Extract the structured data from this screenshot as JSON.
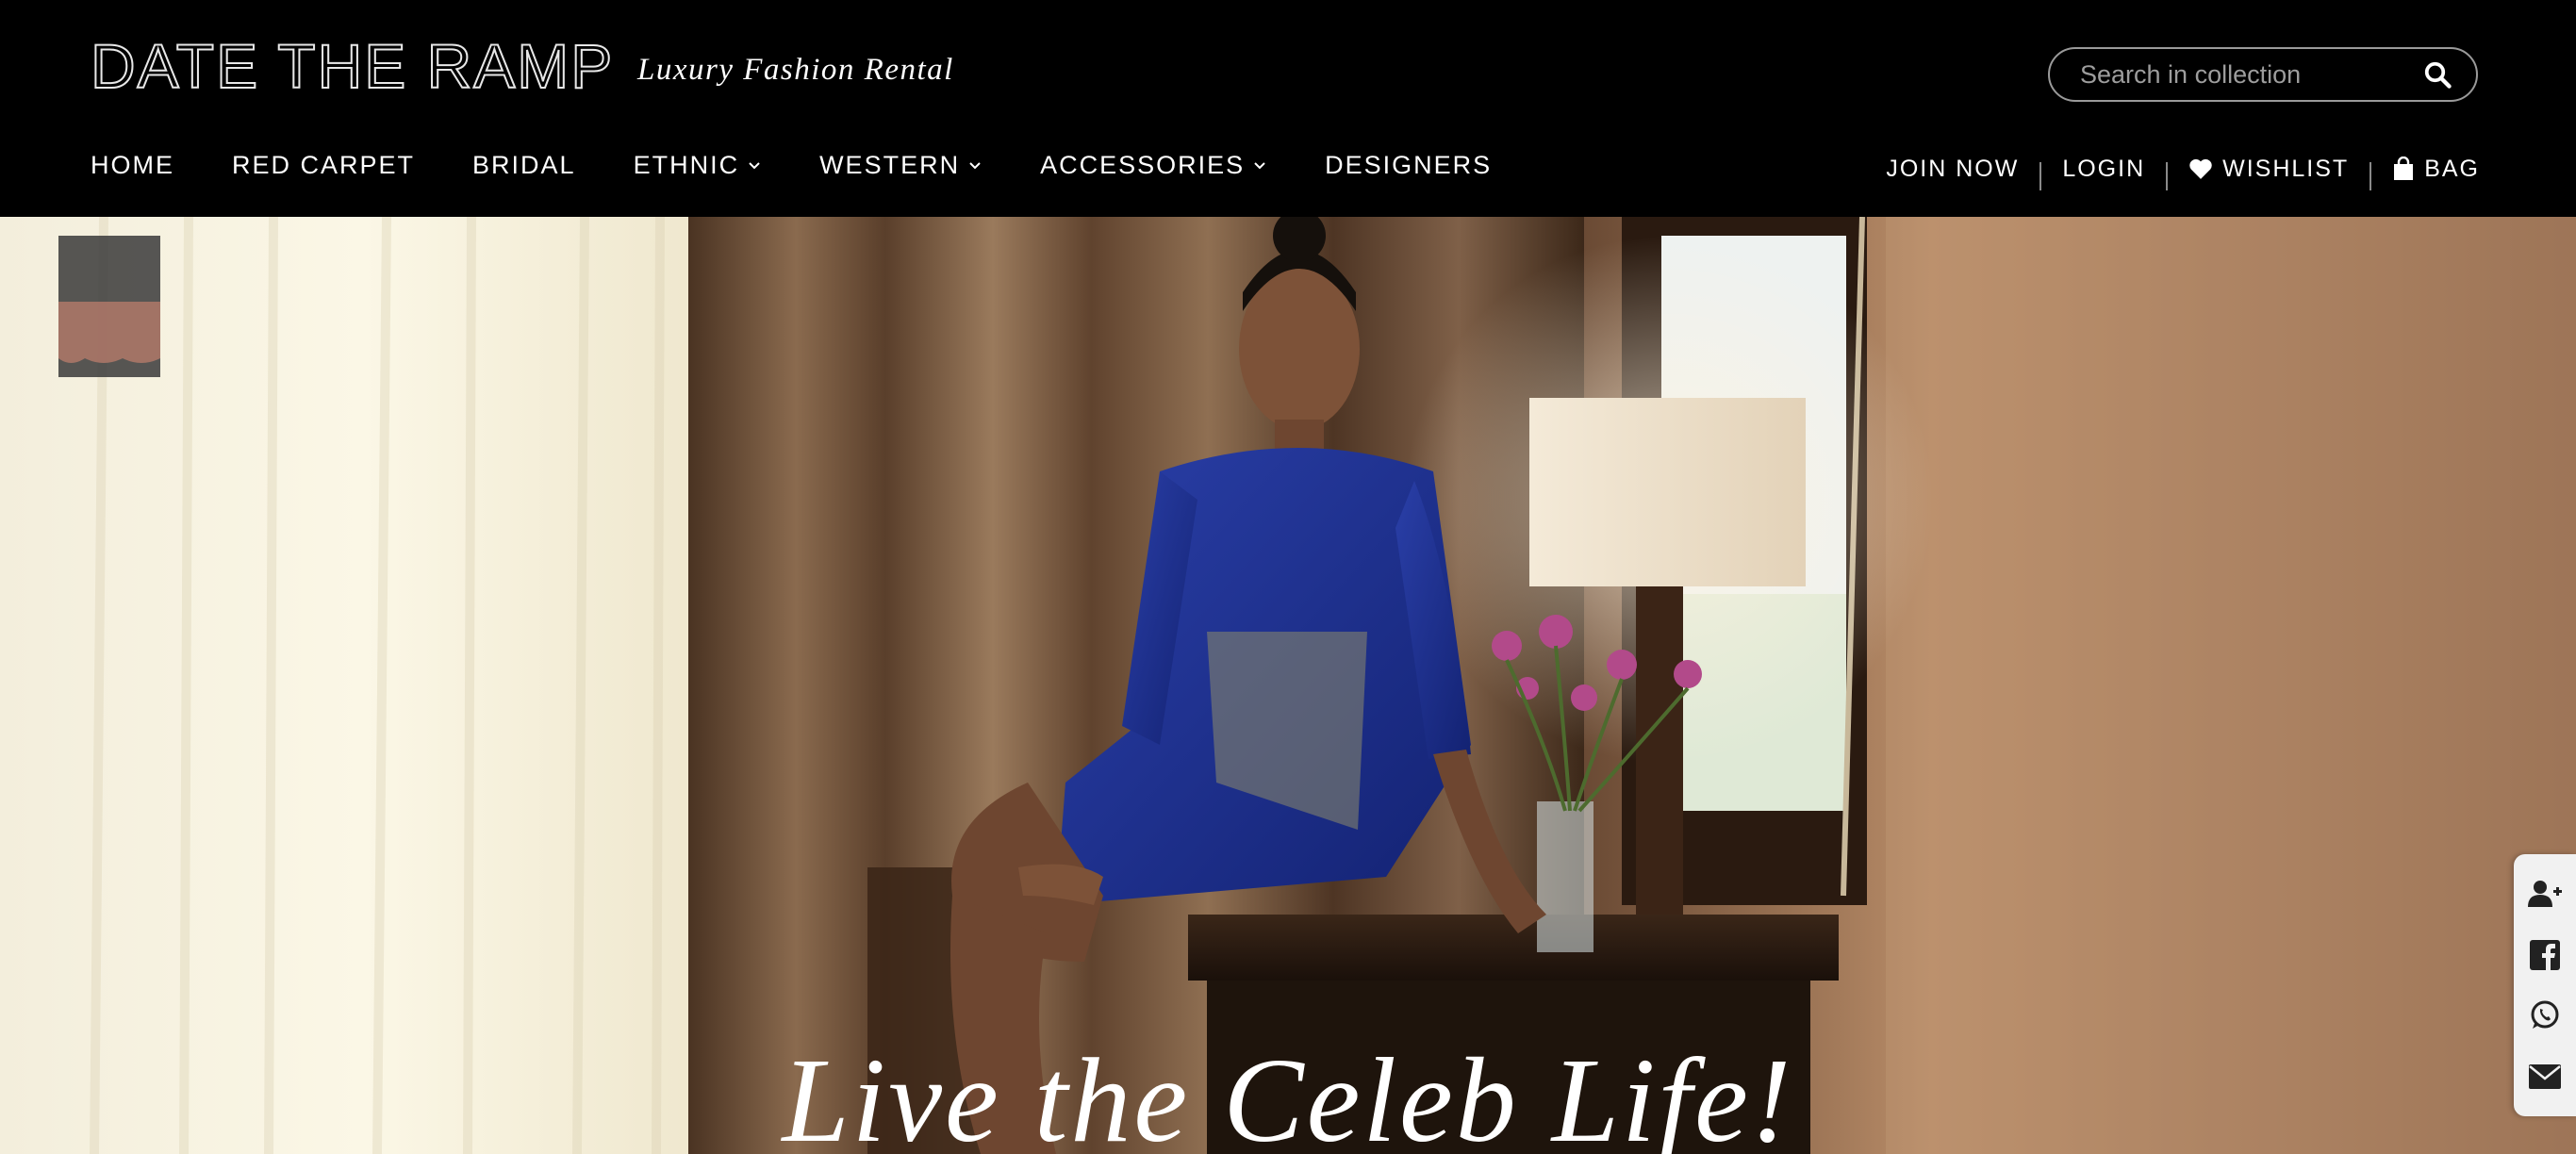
{
  "brand": {
    "logo_text": "DATE THE RAMP",
    "tagline": "Luxury Fashion Rental"
  },
  "search": {
    "placeholder": "Search in collection",
    "icon": "search-icon"
  },
  "nav": {
    "items": [
      {
        "label": "HOME",
        "dropdown": false
      },
      {
        "label": "RED CARPET",
        "dropdown": false
      },
      {
        "label": "BRIDAL",
        "dropdown": false
      },
      {
        "label": "ETHNIC",
        "dropdown": true
      },
      {
        "label": "WESTERN",
        "dropdown": true
      },
      {
        "label": "ACCESSORIES",
        "dropdown": true
      },
      {
        "label": "DESIGNERS",
        "dropdown": false
      }
    ]
  },
  "account": {
    "join": "JOIN NOW",
    "login": "LOGIN",
    "wishlist": "WISHLIST",
    "bag": "BAG"
  },
  "hero": {
    "headline": "Live the Celeb Life!"
  },
  "social": {
    "icons": [
      "add-user-icon",
      "facebook-icon",
      "whatsapp-icon",
      "envelope-icon"
    ]
  },
  "colors": {
    "header_bg": "#000000",
    "text": "#ffffff",
    "dress_blue": "#1c2f8c",
    "social_bg": "#f1f1f1"
  }
}
